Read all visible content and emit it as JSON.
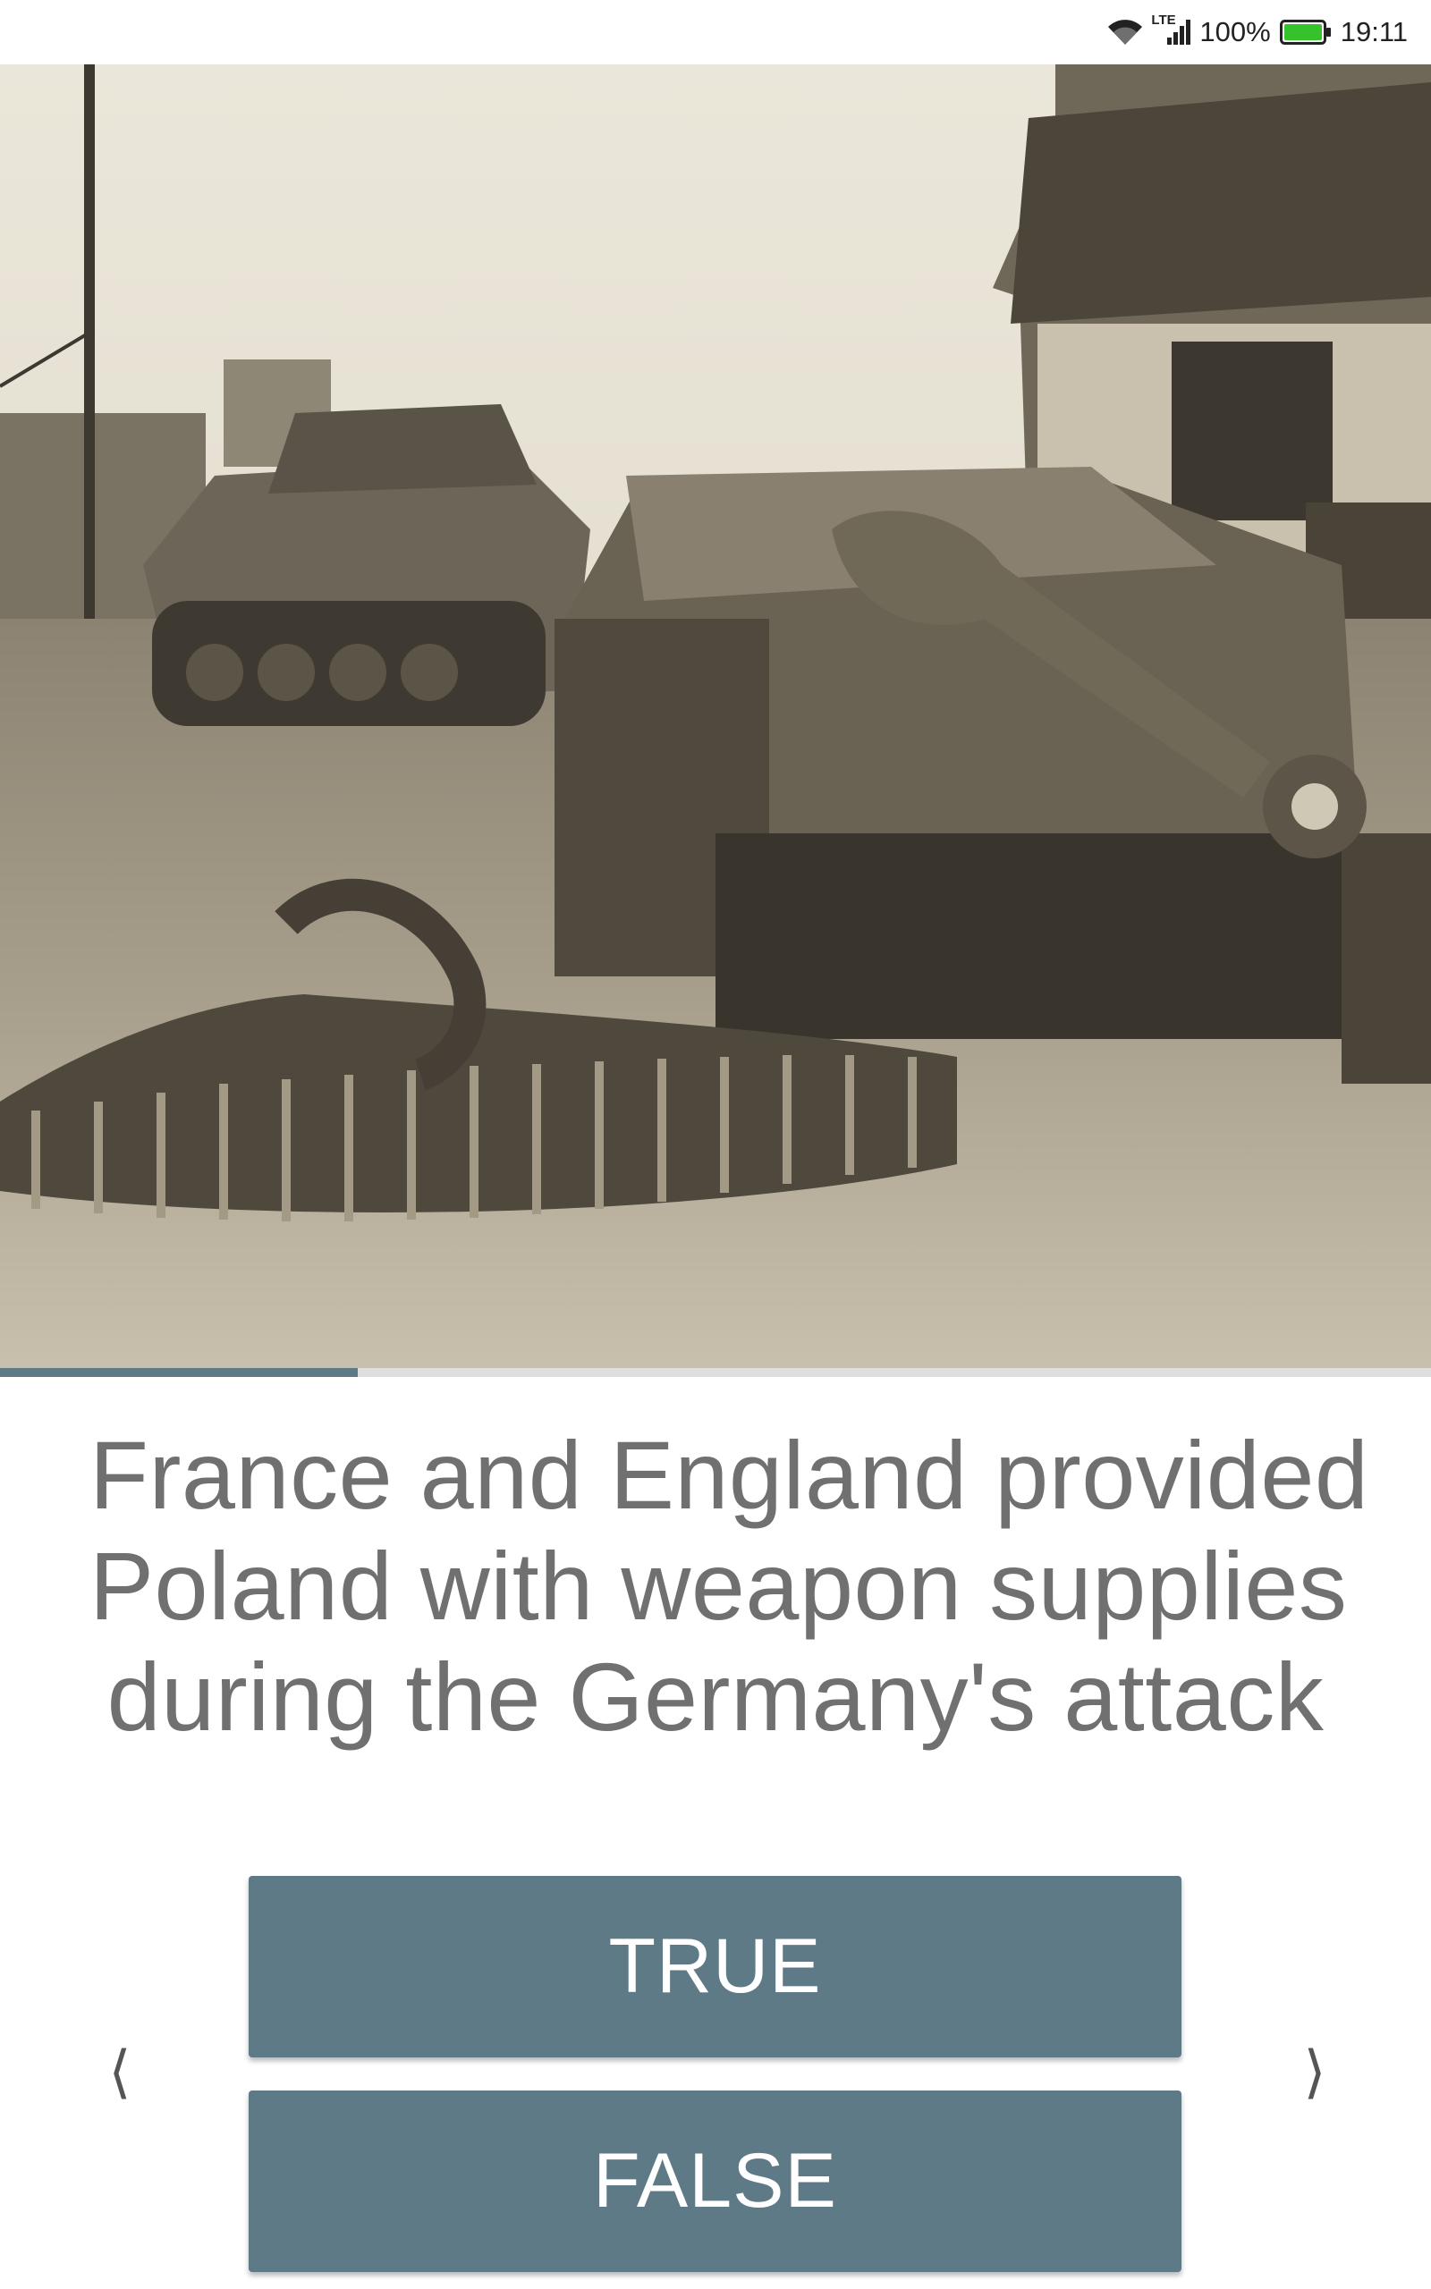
{
  "status_bar": {
    "network_label": "LTE",
    "battery_percent": "100%",
    "time": "19:11"
  },
  "quiz": {
    "progress": 0.25,
    "question_lines": [
      "France and England provided",
      "Poland with weapon supplies",
      "during the Germany's attack"
    ],
    "answers": {
      "true_label": "TRUE",
      "false_label": "FALSE"
    },
    "nav": {
      "prev_icon": "chevron-left-icon",
      "next_icon": "chevron-right-icon"
    }
  },
  "colors": {
    "accent": "#5f7a87",
    "question_text": "#707070",
    "track": "#dedede"
  }
}
